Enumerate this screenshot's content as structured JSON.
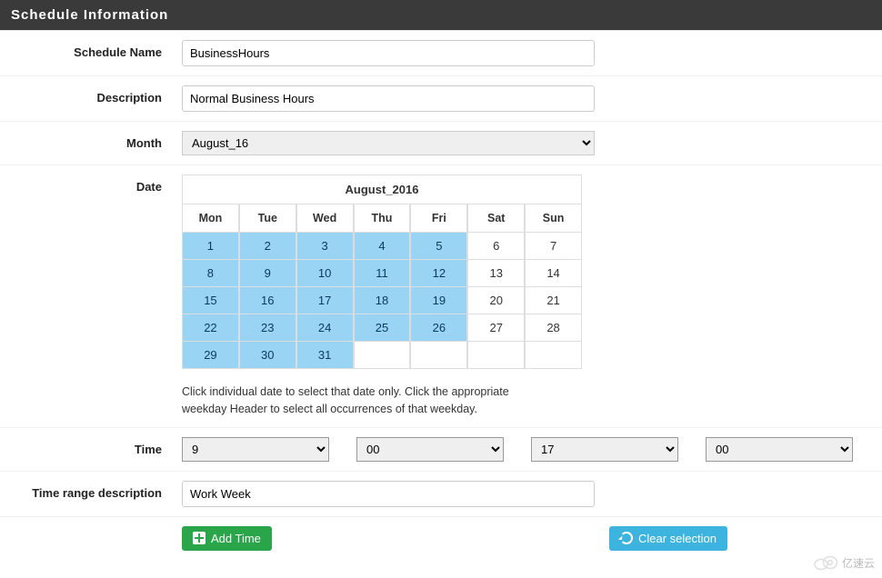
{
  "header": {
    "title": "Schedule Information"
  },
  "fields": {
    "scheduleName": {
      "label": "Schedule Name",
      "value": "BusinessHours"
    },
    "description": {
      "label": "Description",
      "value": "Normal Business Hours"
    },
    "month": {
      "label": "Month",
      "value": "August_16"
    },
    "date": {
      "label": "Date"
    },
    "time": {
      "label": "Time"
    },
    "timeRangeDesc": {
      "label": "Time range description",
      "value": "Work Week"
    }
  },
  "calendar": {
    "title": "August_2016",
    "weekdays": [
      "Mon",
      "Tue",
      "Wed",
      "Thu",
      "Fri",
      "Sat",
      "Sun"
    ],
    "cells": [
      {
        "d": 1,
        "sel": true
      },
      {
        "d": 2,
        "sel": true
      },
      {
        "d": 3,
        "sel": true
      },
      {
        "d": 4,
        "sel": true
      },
      {
        "d": 5,
        "sel": true
      },
      {
        "d": 6,
        "sel": false
      },
      {
        "d": 7,
        "sel": false
      },
      {
        "d": 8,
        "sel": true
      },
      {
        "d": 9,
        "sel": true
      },
      {
        "d": 10,
        "sel": true
      },
      {
        "d": 11,
        "sel": true
      },
      {
        "d": 12,
        "sel": true
      },
      {
        "d": 13,
        "sel": false
      },
      {
        "d": 14,
        "sel": false
      },
      {
        "d": 15,
        "sel": true
      },
      {
        "d": 16,
        "sel": true
      },
      {
        "d": 17,
        "sel": true
      },
      {
        "d": 18,
        "sel": true
      },
      {
        "d": 19,
        "sel": true
      },
      {
        "d": 20,
        "sel": false
      },
      {
        "d": 21,
        "sel": false
      },
      {
        "d": 22,
        "sel": true
      },
      {
        "d": 23,
        "sel": true
      },
      {
        "d": 24,
        "sel": true
      },
      {
        "d": 25,
        "sel": true
      },
      {
        "d": 26,
        "sel": true
      },
      {
        "d": 27,
        "sel": false
      },
      {
        "d": 28,
        "sel": false
      },
      {
        "d": 29,
        "sel": true
      },
      {
        "d": 30,
        "sel": true
      },
      {
        "d": 31,
        "sel": true
      },
      {
        "d": "",
        "sel": false
      },
      {
        "d": "",
        "sel": false
      },
      {
        "d": "",
        "sel": false
      },
      {
        "d": "",
        "sel": false
      }
    ],
    "hint": "Click individual date to select that date only. Click the appropriate weekday Header to select all occurrences of that weekday."
  },
  "time": {
    "startHour": "9",
    "startMin": "00",
    "endHour": "17",
    "endMin": "00"
  },
  "buttons": {
    "addTime": "Add Time",
    "clearSelection": "Clear selection"
  },
  "watermark": "亿速云"
}
